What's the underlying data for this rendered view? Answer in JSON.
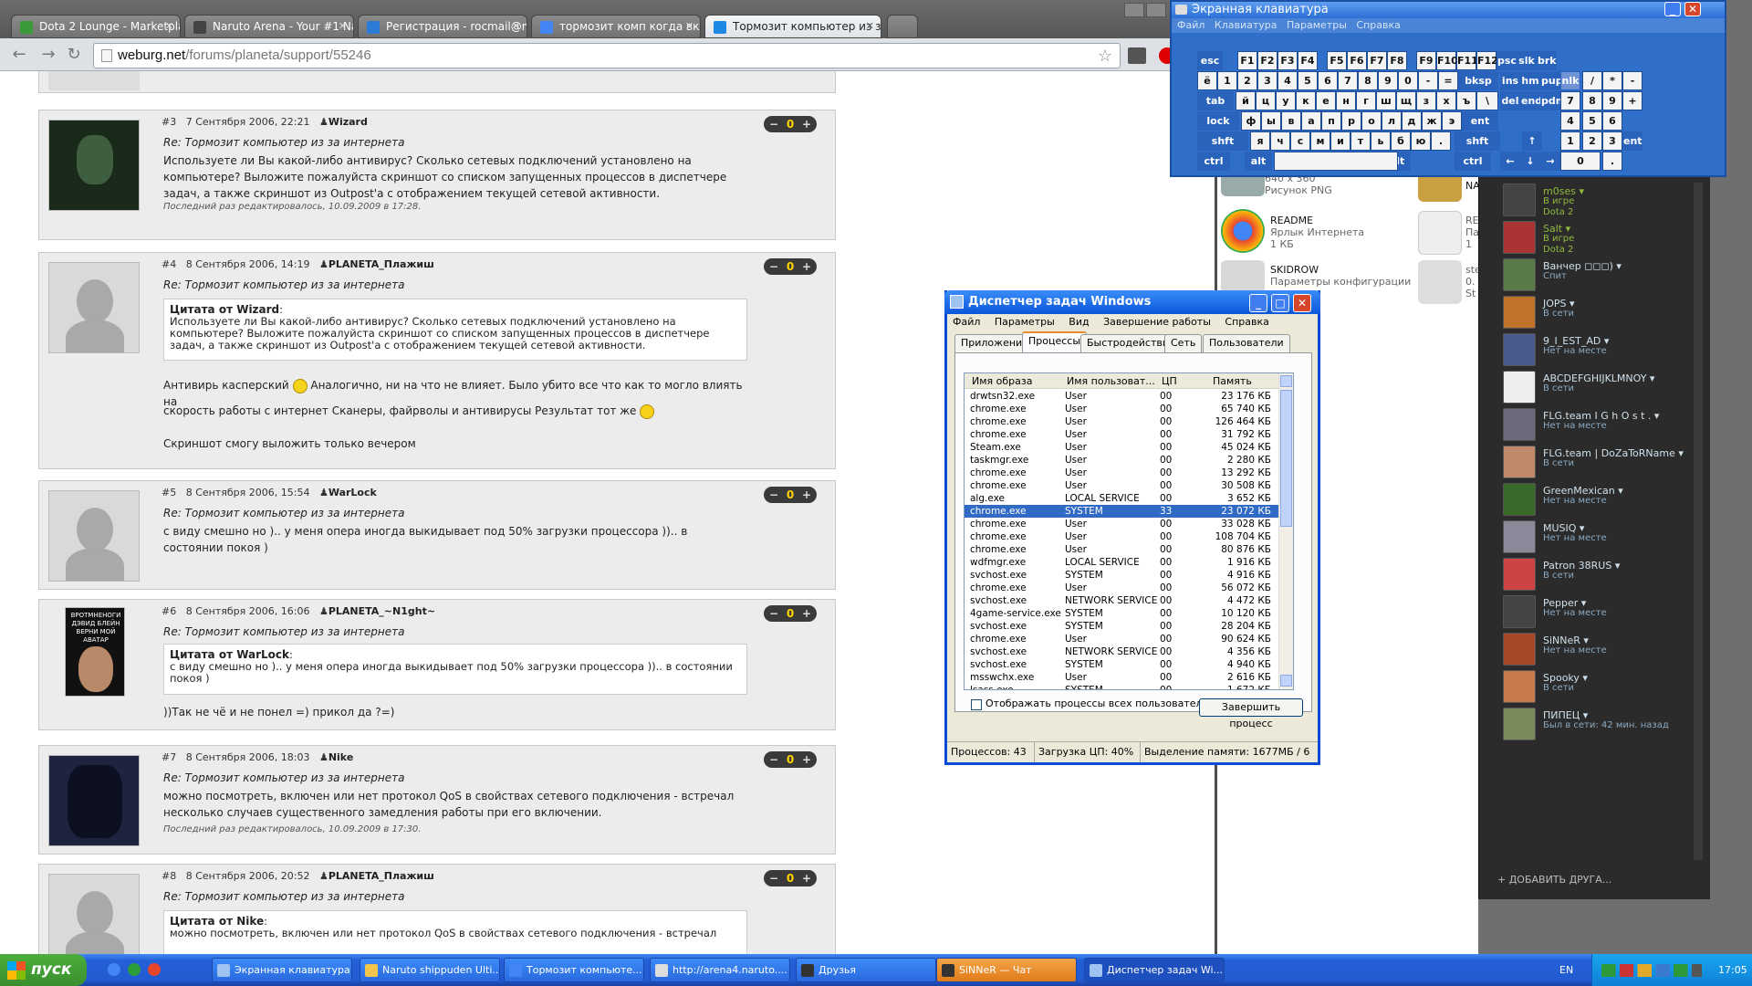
{
  "browser": {
    "tabs": [
      {
        "label": "Dota 2 Lounge - Marketplac",
        "color": "#3a9a3a"
      },
      {
        "label": "Naruto Arena - Your #1 Nar",
        "color": "#444"
      },
      {
        "label": "Регистрация - rocmail@mai",
        "color": "#2b7bd6"
      },
      {
        "label": "тормозит комп когда вклю",
        "color": "#4285f4"
      },
      {
        "label": "Тормозит компьютер из за",
        "color": "#1e88e5"
      }
    ],
    "url_domain": "weburg.net",
    "url_path": "/forums/planeta/support/55246"
  },
  "posts": [
    {
      "num": "#3",
      "date": "7 Сентября 2006, 22:21",
      "author": "Wizard",
      "rating": "0",
      "subject": "Re: Тормозит компьютер из за интернета",
      "body": "Используете ли Вы какой-либо антивирус? Сколько сетевых подключений установлено на компьютере? Выложите пожалуйста скриншот со списком запущенных процессов в диспетчере задач, а также скриншот из Outpost'a с отображением текущей сетевой активности.",
      "edited": "Последний раз редактировалось, 10.09.2009 в 17:28."
    },
    {
      "num": "#4",
      "date": "8 Сентября 2006, 14:19",
      "author": "PLANETA_Плажиш",
      "rating": "0",
      "subject": "Re: Тормозит компьютер из за интернета",
      "quote_author": "Цитата от Wizard",
      "quote_text": "Используете ли Вы какой-либо антивирус? Сколько сетевых подключений установлено на компьютере? Выложите пожалуйста скриншот со списком запущенных процессов в диспетчере задач, а также скриншот из Outpost'a с отображением текущей сетевой активности.",
      "body1": "Антивирь касперский",
      "body2": "Аналогично, ни на что не влияет. Было убито все что как то могло влиять на",
      "body3": "скорость работы с интернет Сканеры, файрволы и антивирусы Результат тот же",
      "body4": "Скриншот смогу выложить только вечером"
    },
    {
      "num": "#5",
      "date": "8 Сентября 2006, 15:54",
      "author": "WarLock",
      "rating": "0",
      "subject": "Re: Тормозит компьютер из за интернета",
      "body": "с виду смешно но ).. у меня опера иногда выкидывает под 50% загрузки процессора )).. в состоянии покоя )"
    },
    {
      "num": "#6",
      "date": "8 Сентября 2006, 16:06",
      "author": "PLANETA_~N1ght~",
      "rating": "0",
      "subject": "Re: Тормозит компьютер из за интернета",
      "quote_author": "Цитата от WarLock",
      "quote_text": "с виду смешно но ).. у меня опера иногда выкидывает под 50% загрузки процессора )).. в состоянии покоя )",
      "body": "))Так не чё и не понел =) прикол да ?=)",
      "avatar_text": "ВРОТМНЕНОГИ ДЭВИД БЛЕЙН ВЕРНИ МОЙ АВАТАР"
    },
    {
      "num": "#7",
      "date": "8 Сентября 2006, 18:03",
      "author": "Nike",
      "rating": "0",
      "subject": "Re: Тормозит компьютер из за интернета",
      "body": "можно посмотреть, включен или нет протокол QoS в свойствах сетевого подключения - встречал несколько случаев существенного замедления работы при его включении.",
      "edited": "Последний раз редактировалось, 10.09.2009 в 17:30."
    },
    {
      "num": "#8",
      "date": "8 Сентября 2006, 20:52",
      "author": "PLANETA_Плажиш",
      "rating": "0",
      "subject": "Re: Тормозит компьютер из за интернета",
      "quote_author": "Цитата от Nike",
      "quote_text": "можно посмотреть, включен или нет протокол QoS в свойствах сетевого подключения - встречал"
    }
  ],
  "desktop": {
    "items": [
      {
        "name": "",
        "sub1": "640 x 360",
        "sub2": "Рисунок PNG"
      },
      {
        "name": "README",
        "sub1": "Ярлык Интернета",
        "sub2": "1 КБ"
      },
      {
        "name": "SKIDROW",
        "sub1": "Параметры конфигурации",
        "sub2": ""
      }
    ],
    "partial": [
      "NA",
      "RE",
      "Па",
      "1",
      "ste",
      "0.",
      "St"
    ]
  },
  "osk": {
    "title": "Экранная клавиатура",
    "menu": [
      "Файл",
      "Клавиатура",
      "Параметры",
      "Справка"
    ],
    "row0": [
      "esc",
      "F1",
      "F2",
      "F3",
      "F4",
      "F5",
      "F6",
      "F7",
      "F8",
      "F9",
      "F10",
      "F11",
      "F12",
      "psc",
      "slk",
      "brk"
    ],
    "row1": [
      "ё",
      "1",
      "2",
      "3",
      "4",
      "5",
      "6",
      "7",
      "8",
      "9",
      "0",
      "-",
      "=",
      "bksp",
      "ins",
      "hm",
      "pup",
      "nlk",
      "/",
      "*",
      "-"
    ],
    "row2": [
      "tab",
      "й",
      "ц",
      "у",
      "к",
      "е",
      "н",
      "г",
      "ш",
      "щ",
      "з",
      "х",
      "ъ",
      "\\",
      "del",
      "end",
      "pdn",
      "7",
      "8",
      "9",
      "+"
    ],
    "row3": [
      "lock",
      "ф",
      "ы",
      "в",
      "а",
      "п",
      "р",
      "о",
      "л",
      "д",
      "ж",
      "э",
      "ent",
      "4",
      "5",
      "6"
    ],
    "row4": [
      "shft",
      "я",
      "ч",
      "с",
      "м",
      "и",
      "т",
      "ь",
      "б",
      "ю",
      ".",
      "shft",
      "↑",
      "1",
      "2",
      "3",
      "ent"
    ],
    "row5": [
      "ctrl",
      "alt",
      "alt",
      "ctrl",
      "←",
      "↓",
      "→",
      "0",
      "."
    ]
  },
  "taskmgr": {
    "title": "Диспетчер задач Windows",
    "menu": [
      "Файл",
      "Параметры",
      "Вид",
      "Завершение работы",
      "Справка"
    ],
    "tabs": [
      "Приложения",
      "Процессы",
      "Быстродействие",
      "Сеть",
      "Пользователи"
    ],
    "headers": [
      "Имя образа",
      "Имя пользоват...",
      "ЦП",
      "Память"
    ],
    "rows": [
      [
        "drwtsn32.exe",
        "User",
        "00",
        "23 176 КБ"
      ],
      [
        "chrome.exe",
        "User",
        "00",
        "65 740 КБ"
      ],
      [
        "chrome.exe",
        "User",
        "00",
        "126 464 КБ"
      ],
      [
        "chrome.exe",
        "User",
        "00",
        "31 792 КБ"
      ],
      [
        "Steam.exe",
        "User",
        "00",
        "45 024 КБ"
      ],
      [
        "taskmgr.exe",
        "User",
        "00",
        "2 280 КБ"
      ],
      [
        "chrome.exe",
        "User",
        "00",
        "13 292 КБ"
      ],
      [
        "chrome.exe",
        "User",
        "00",
        "30 508 КБ"
      ],
      [
        "alg.exe",
        "LOCAL SERVICE",
        "00",
        "3 652 КБ"
      ],
      [
        "chrome.exe",
        "SYSTEM",
        "33",
        "23 072 КБ"
      ],
      [
        "chrome.exe",
        "User",
        "00",
        "33 028 КБ"
      ],
      [
        "chrome.exe",
        "User",
        "00",
        "108 704 КБ"
      ],
      [
        "chrome.exe",
        "User",
        "00",
        "80 876 КБ"
      ],
      [
        "wdfmgr.exe",
        "LOCAL SERVICE",
        "00",
        "1 916 КБ"
      ],
      [
        "svchost.exe",
        "SYSTEM",
        "00",
        "4 916 КБ"
      ],
      [
        "chrome.exe",
        "User",
        "00",
        "56 072 КБ"
      ],
      [
        "svchost.exe",
        "NETWORK SERVICE",
        "00",
        "4 472 КБ"
      ],
      [
        "4game-service.exe",
        "SYSTEM",
        "00",
        "10 120 КБ"
      ],
      [
        "svchost.exe",
        "SYSTEM",
        "00",
        "28 204 КБ"
      ],
      [
        "chrome.exe",
        "User",
        "00",
        "90 624 КБ"
      ],
      [
        "svchost.exe",
        "NETWORK SERVICE",
        "00",
        "4 356 КБ"
      ],
      [
        "svchost.exe",
        "SYSTEM",
        "00",
        "4 940 КБ"
      ],
      [
        "msswchx.exe",
        "User",
        "00",
        "2 616 КБ"
      ],
      [
        "lsass.exe",
        "SYSTEM",
        "00",
        "1 672 КБ"
      ]
    ],
    "selected_row": 9,
    "show_all_label": "Отображать процессы всех пользователей",
    "end_process": "Завершить процесс",
    "status": [
      "Процессов: 43",
      "Загрузка ЦП: 40%",
      "Выделение памяти: 1677МБ / 6"
    ]
  },
  "friends": {
    "list": [
      {
        "name": "m0ses",
        "status": "В игре",
        "status2": "Dota 2",
        "ingame": true,
        "color": "#444"
      },
      {
        "name": "Salt",
        "status": "В игре",
        "status2": "Dota 2",
        "ingame": true,
        "color": "#a33"
      },
      {
        "name": "Ванчер ◻◻◻)",
        "status": "Спит",
        "status2": "",
        "ingame": false,
        "color": "#5a7a4a"
      },
      {
        "name": "JOPS",
        "status": "В сети",
        "status2": "",
        "ingame": false,
        "color": "#c0722a"
      },
      {
        "name": "9_I_EST_AD",
        "status": "Нет на месте",
        "status2": "",
        "ingame": false,
        "color": "#4a5a8a"
      },
      {
        "name": "ABCDEFGHIJKLMNOY",
        "status": "В сети",
        "status2": "",
        "ingame": false,
        "color": "#eee"
      },
      {
        "name": "FLG.team I G h O s t .",
        "status": "Нет на месте",
        "status2": "",
        "ingame": false,
        "color": "#6a6a7a"
      },
      {
        "name": "FLG.team | DoZaToRName",
        "status": "В сети",
        "status2": "",
        "ingame": false,
        "color": "#c08a6a"
      },
      {
        "name": "GreenMexican",
        "status": "Нет на месте",
        "status2": "",
        "ingame": false,
        "color": "#3a6a2a"
      },
      {
        "name": "MUSIQ",
        "status": "Нет на месте",
        "status2": "",
        "ingame": false,
        "color": "#8a8a9a"
      },
      {
        "name": "Patron 38RUS",
        "status": "В сети",
        "status2": "",
        "ingame": false,
        "color": "#c44"
      },
      {
        "name": "Pepper",
        "status": "Нет на месте",
        "status2": "",
        "ingame": false,
        "color": "#444"
      },
      {
        "name": "SiNNeR",
        "status": "Нет на месте",
        "status2": "",
        "ingame": false,
        "color": "#a44a2a"
      },
      {
        "name": "Spooky",
        "status": "В сети",
        "status2": "",
        "ingame": false,
        "color": "#c87a4a"
      },
      {
        "name": "ПИПЕЦ",
        "status": "Был в сети: 42 мин. назад",
        "status2": "",
        "ingame": false,
        "color": "#7a8a5a"
      }
    ],
    "add_friend": "+ ДОБАВИТЬ ДРУГА..."
  },
  "taskbar": {
    "start": "пуск",
    "buttons": [
      {
        "label": "Экранная клавиатура",
        "icon": "#9ec3f0",
        "active": false,
        "orange": false
      },
      {
        "label": "Naruto shippuden Ulti...",
        "icon": "#f3c44a",
        "active": false,
        "orange": false
      },
      {
        "label": "Тормозит компьюте...",
        "icon": "#4285f4",
        "active": false,
        "orange": false
      },
      {
        "label": "http://arena4.naruto....",
        "icon": "#ddd",
        "active": false,
        "orange": false
      },
      {
        "label": "Друзья",
        "icon": "#333",
        "active": false,
        "orange": false
      },
      {
        "label": "SiNNeR — Чат",
        "icon": "#333",
        "active": false,
        "orange": true
      },
      {
        "label": "Диспетчер задач Wi...",
        "icon": "#9ec3f0",
        "active": true,
        "orange": false
      }
    ],
    "lang": "EN",
    "time": "17:05"
  }
}
